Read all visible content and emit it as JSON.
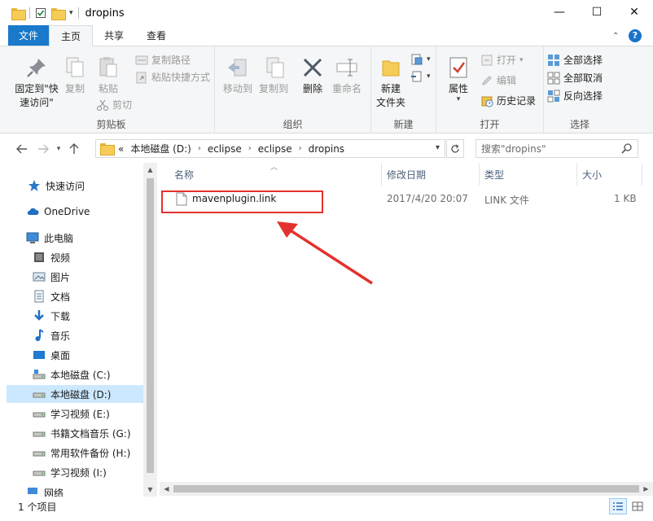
{
  "window": {
    "title": "dropins",
    "minimize_glyph": "—",
    "maximize_glyph": "☐",
    "close_glyph": "✕"
  },
  "ribbon_tabs": [
    "文件",
    "主页",
    "共享",
    "查看"
  ],
  "ribbon": {
    "clipboard": {
      "label": "剪贴板",
      "pin": "固定到\"快速访问\"",
      "copy": "复制",
      "paste": "粘贴",
      "copy_path": "复制路径",
      "paste_shortcut": "粘贴快捷方式",
      "cut": "剪切"
    },
    "organize": {
      "label": "组织",
      "move_to": "移动到",
      "copy_to": "复制到",
      "delete": "删除",
      "rename": "重命名"
    },
    "new": {
      "label": "新建",
      "new_folder": "新建\n文件夹"
    },
    "open": {
      "label": "打开",
      "properties": "属性",
      "open": "打开",
      "edit": "编辑",
      "history": "历史记录"
    },
    "select": {
      "label": "选择",
      "select_all": "全部选择",
      "select_none": "全部取消",
      "invert": "反向选择"
    }
  },
  "address": {
    "breadcrumbs": [
      "本地磁盘 (D:)",
      "eclipse",
      "eclipse",
      "dropins"
    ],
    "overflow": "«",
    "search_placeholder": "搜索\"dropins\""
  },
  "nav_pane": [
    {
      "label": "快速访问",
      "icon": "star-icon"
    },
    {
      "label": "OneDrive",
      "icon": "cloud-icon"
    },
    {
      "label": "此电脑",
      "icon": "computer-icon"
    },
    {
      "label": "视频",
      "icon": "video-folder-icon"
    },
    {
      "label": "图片",
      "icon": "pictures-folder-icon"
    },
    {
      "label": "文档",
      "icon": "documents-folder-icon"
    },
    {
      "label": "下载",
      "icon": "download-icon"
    },
    {
      "label": "音乐",
      "icon": "music-icon"
    },
    {
      "label": "桌面",
      "icon": "desktop-icon"
    },
    {
      "label": "本地磁盘 (C:)",
      "icon": "drive-c-icon"
    },
    {
      "label": "本地磁盘 (D:)",
      "icon": "drive-icon",
      "selected": true
    },
    {
      "label": "学习视频 (E:)",
      "icon": "drive-icon"
    },
    {
      "label": "书籍文档音乐 (G:)",
      "icon": "drive-icon"
    },
    {
      "label": "常用软件备份 (H:)",
      "icon": "drive-icon"
    },
    {
      "label": "学习视频 (I:)",
      "icon": "drive-icon"
    },
    {
      "label": "网络",
      "icon": "network-icon"
    }
  ],
  "columns": [
    "名称",
    "修改日期",
    "类型",
    "大小"
  ],
  "files": [
    {
      "name": "mavenplugin.link",
      "modified": "2017/4/20 20:07",
      "type": "LINK 文件",
      "size": "1 KB"
    }
  ],
  "status": {
    "item_count": "1 个项目"
  },
  "colors": {
    "file_tab": "#1979ca",
    "selection": "#cce8ff",
    "annotation": "#e3312d"
  }
}
